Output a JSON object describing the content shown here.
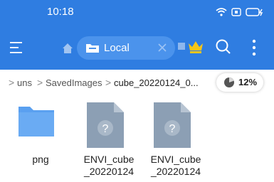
{
  "status_bar": {
    "time": "10:18",
    "icons": [
      "wifi-icon",
      "screen-record-icon",
      "battery-charging-icon"
    ]
  },
  "toolbar": {
    "tab_label": "Local",
    "icons": [
      "menu-icon",
      "home-icon",
      "folder-icon",
      "close-icon",
      "crown-icon",
      "search-icon",
      "more-icon"
    ],
    "accent_color": "#2f7de1"
  },
  "breadcrumb": {
    "segments": [
      "uns",
      "SavedImages",
      "cube_20220124_0..."
    ],
    "storage_used": "12%"
  },
  "files": [
    {
      "name": "png",
      "type": "folder"
    },
    {
      "name_line1": "ENVI_cube",
      "name_line2": "_20220124",
      "type": "unknown"
    },
    {
      "name_line1": "ENVI_cube",
      "name_line2": "_20220124",
      "type": "unknown"
    }
  ]
}
